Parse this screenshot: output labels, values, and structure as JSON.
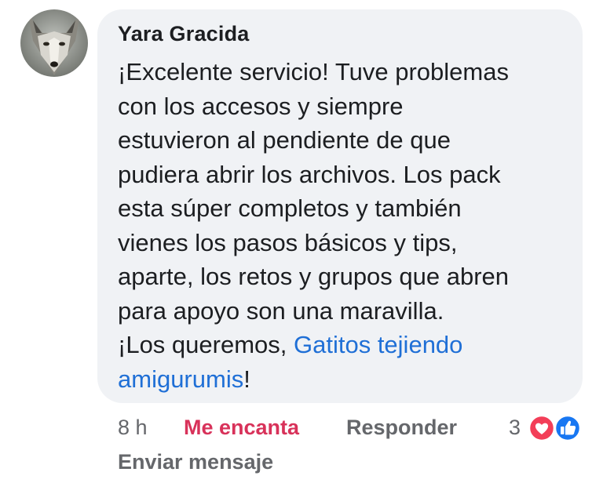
{
  "comment": {
    "author": "Yara Gracida",
    "body_lines": [
      "¡Excelente servicio! Tuve problemas",
      "con los accesos y siempre",
      "estuvieron al pendiente de que",
      "pudiera abrir los archivos. Los pack",
      "esta súper completos y también",
      "vienes los pasos básicos y tips,",
      "aparte, los retos y grupos que abren",
      "para apoyo son una maravilla."
    ],
    "last_line_prefix": "¡Los queremos, ",
    "mention_part1": "Gatitos tejiendo",
    "mention_part2": "amigurumis",
    "last_line_suffix": "!"
  },
  "actions": {
    "time": "8 h",
    "reaction_label": "Me encanta",
    "reply_label": "Responder",
    "reaction_count": "3",
    "reaction_icons": [
      "heart-icon",
      "like-icon"
    ],
    "send_message_label": "Enviar mensaje"
  },
  "colors": {
    "bubble_bg": "#f0f2f5",
    "mention": "#1f6fd6",
    "reaction_active": "#d8325a",
    "muted": "#65676b",
    "heart": "#f33e58",
    "like": "#1877f2"
  }
}
